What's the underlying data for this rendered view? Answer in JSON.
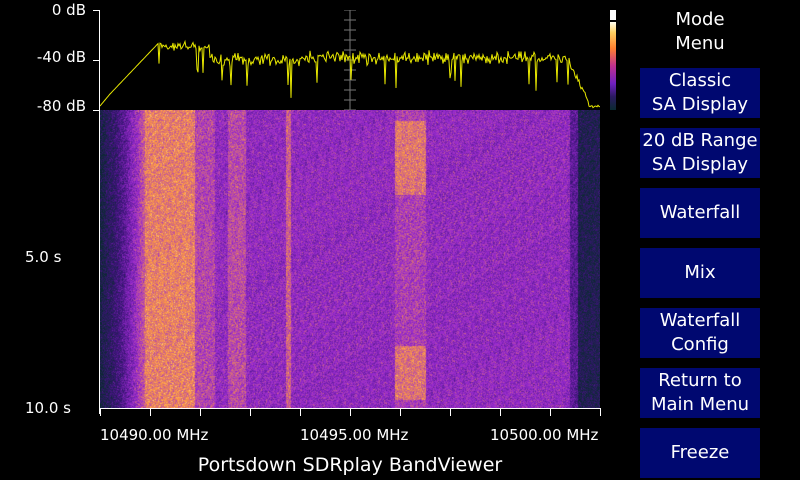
{
  "spectrum": {
    "y_labels": [
      "0 dB",
      "-40 dB",
      "-80 dB"
    ]
  },
  "waterfall": {
    "time_labels": [
      "5.0 s",
      "10.0 s"
    ]
  },
  "frequency_axis": {
    "labels": [
      "10490.00 MHz",
      "10495.00 MHz",
      "10500.00 MHz"
    ]
  },
  "title": "Portsdown SDRplay BandViewer",
  "menu": {
    "title": "Mode\nMenu",
    "buttons": [
      {
        "label": "Classic\nSA Display"
      },
      {
        "label": "20 dB Range\nSA Display"
      },
      {
        "label": "Waterfall"
      },
      {
        "label": "Mix"
      },
      {
        "label": "Waterfall\nConfig"
      },
      {
        "label": "Return to\nMain Menu"
      },
      {
        "label": "Freeze"
      }
    ]
  },
  "colors": {
    "button_bg": "#000870",
    "trace": "#e8e800",
    "waterfall_low": "#0a2a30",
    "waterfall_mid": "#9a2bd0",
    "waterfall_high": "#ff9a40"
  }
}
